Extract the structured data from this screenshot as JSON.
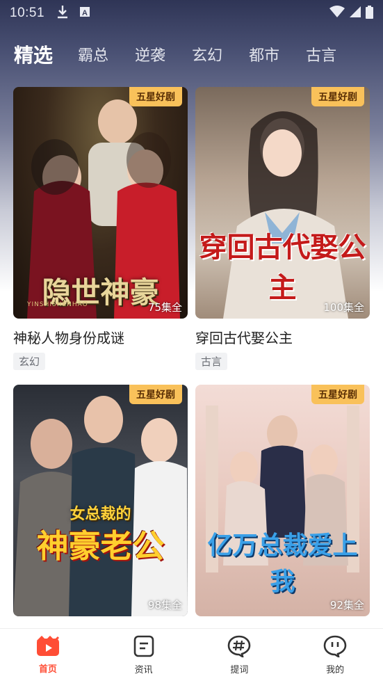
{
  "status_bar": {
    "time": "10:51"
  },
  "tabs": [
    {
      "label": "精选",
      "active": true
    },
    {
      "label": "霸总"
    },
    {
      "label": "逆袭"
    },
    {
      "label": "玄幻"
    },
    {
      "label": "都市"
    },
    {
      "label": "古言"
    }
  ],
  "cards": [
    {
      "title": "神秘人物身份成谜",
      "genre": "玄幻",
      "episodes": "75集全",
      "badge": "五星好剧",
      "poster_text": "隐世神豪",
      "poster_subtext": "YINSHISHENHAO"
    },
    {
      "title": "穿回古代娶公主",
      "genre": "古言",
      "episodes": "100集全",
      "badge": "五星好剧",
      "poster_text": "穿回古代娶公主"
    },
    {
      "title": "",
      "genre": "",
      "episodes": "98集全",
      "badge": "五星好剧",
      "poster_text": "神豪老公",
      "poster_subtext": "女总裁的"
    },
    {
      "title": "",
      "genre": "",
      "episodes": "92集全",
      "badge": "五星好剧",
      "poster_text": "亿万总裁爱上我"
    }
  ],
  "bottom_nav": [
    {
      "label": "首页",
      "icon": "home-icon",
      "active": true
    },
    {
      "label": "资讯",
      "icon": "news-icon"
    },
    {
      "label": "提词",
      "icon": "hashtag-icon"
    },
    {
      "label": "我的",
      "icon": "profile-icon"
    }
  ],
  "colors": {
    "accent": "#ff4d35",
    "badge": "#f9c15a"
  }
}
